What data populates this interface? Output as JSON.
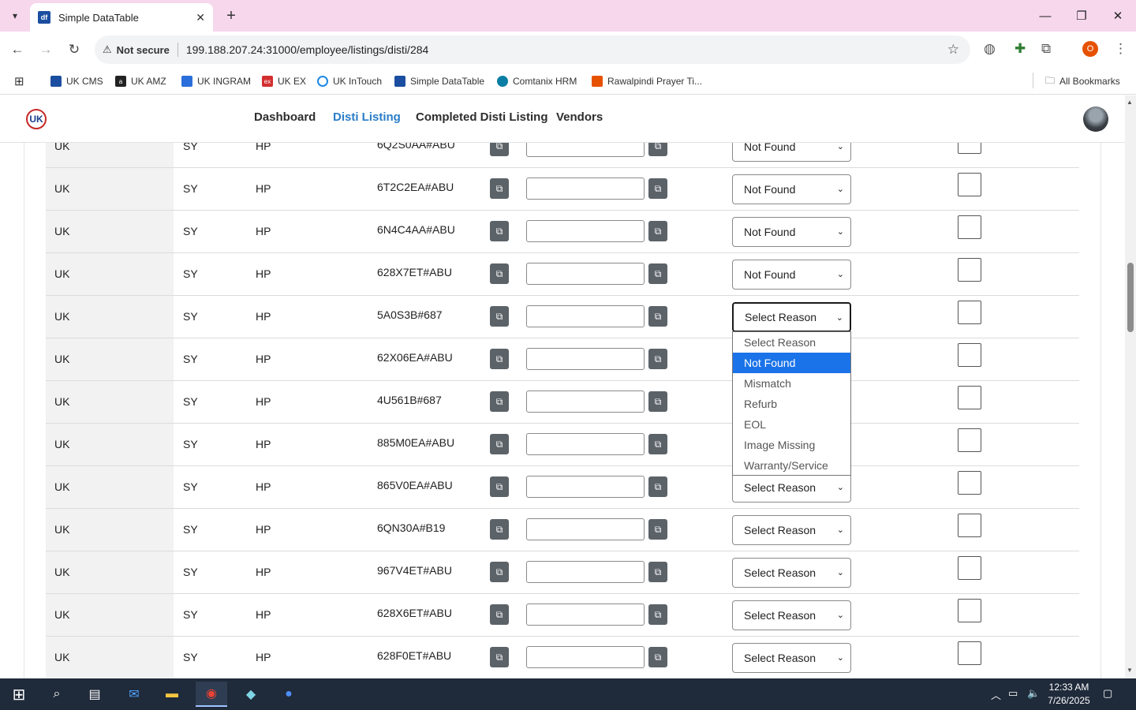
{
  "browser": {
    "tab_title": "Simple DataTable",
    "tab_favicon": "df",
    "security_label": "Not secure",
    "url": "199.188.207.24:31000/employee/listings/disti/284",
    "profile_initial": "O"
  },
  "bookmarks": [
    {
      "label": "UK CMS",
      "icon": "cms-icon",
      "color": "#1b4ea0"
    },
    {
      "label": "UK AMZ",
      "icon": "amazon-icon",
      "color": "#222222"
    },
    {
      "label": "UK INGRAM",
      "icon": "ingram-icon",
      "color": "#2a6fdb"
    },
    {
      "label": "UK EX",
      "icon": "ex-icon",
      "color": "#d32f2f"
    },
    {
      "label": "UK InTouch",
      "icon": "intouch-icon",
      "color": "#1e88e5"
    },
    {
      "label": "Simple DataTable",
      "icon": "datatable-icon",
      "color": "#1b4ea0"
    },
    {
      "label": "Comtanix HRM",
      "icon": "hrm-icon",
      "color": "#0a7ea4"
    },
    {
      "label": "Rawalpindi Prayer Ti...",
      "icon": "prayer-icon",
      "color": "#e65100"
    }
  ],
  "all_bookmarks_label": "All Bookmarks",
  "header": {
    "logo_text": "UK",
    "menu": [
      "Dashboard",
      "Disti Listing",
      "Completed Disti Listing",
      "Vendors"
    ],
    "active_menu": "Disti Listing"
  },
  "rows": [
    {
      "country": "UK",
      "code": "SY",
      "brand": "HP",
      "sku": "6Q2S0AA#ABU",
      "reason": "Not Found"
    },
    {
      "country": "UK",
      "code": "SY",
      "brand": "HP",
      "sku": "6T2C2EA#ABU",
      "reason": "Not Found"
    },
    {
      "country": "UK",
      "code": "SY",
      "brand": "HP",
      "sku": "6N4C4AA#ABU",
      "reason": "Not Found"
    },
    {
      "country": "UK",
      "code": "SY",
      "brand": "HP",
      "sku": "628X7ET#ABU",
      "reason": "Not Found"
    },
    {
      "country": "UK",
      "code": "SY",
      "brand": "HP",
      "sku": "5A0S3B#687",
      "reason": "Select Reason"
    },
    {
      "country": "UK",
      "code": "SY",
      "brand": "HP",
      "sku": "62X06EA#ABU",
      "reason": ""
    },
    {
      "country": "UK",
      "code": "SY",
      "brand": "HP",
      "sku": "4U561B#687",
      "reason": ""
    },
    {
      "country": "UK",
      "code": "SY",
      "brand": "HP",
      "sku": "885M0EA#ABU",
      "reason": ""
    },
    {
      "country": "UK",
      "code": "SY",
      "brand": "HP",
      "sku": "865V0EA#ABU",
      "reason": "Select Reason"
    },
    {
      "country": "UK",
      "code": "SY",
      "brand": "HP",
      "sku": "6QN30A#B19",
      "reason": "Select Reason"
    },
    {
      "country": "UK",
      "code": "SY",
      "brand": "HP",
      "sku": "967V4ET#ABU",
      "reason": "Select Reason"
    },
    {
      "country": "UK",
      "code": "SY",
      "brand": "HP",
      "sku": "628X6ET#ABU",
      "reason": "Select Reason"
    },
    {
      "country": "UK",
      "code": "SY",
      "brand": "HP",
      "sku": "628F0ET#ABU",
      "reason": "Select Reason"
    }
  ],
  "dropdown": {
    "options": [
      "Select Reason",
      "Not Found",
      "Mismatch",
      "Refurb",
      "EOL",
      "Image Missing",
      "Warranty/Service"
    ],
    "highlighted": "Not Found"
  },
  "taskbar": {
    "time": "12:33 AM",
    "date": "7/26/2025"
  },
  "colors": {
    "accent": "#2a7dc8",
    "selection": "#1a73e8",
    "titlebar": "#f6d7ec",
    "copy_button": "#5b6268"
  }
}
